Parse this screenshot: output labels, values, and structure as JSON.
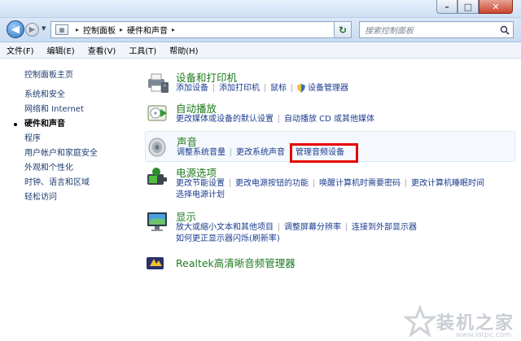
{
  "window": {
    "minimize": "–",
    "maximize": "□",
    "close": "✕"
  },
  "address": {
    "crumbs": [
      "控制面板",
      "硬件和声音"
    ]
  },
  "search": {
    "placeholder": "搜索控制面板"
  },
  "menu": [
    "文件(F)",
    "编辑(E)",
    "查看(V)",
    "工具(T)",
    "帮助(H)"
  ],
  "sidebar": {
    "home": "控制面板主页",
    "items": [
      {
        "label": "系统和安全",
        "active": false
      },
      {
        "label": "网络和 Internet",
        "active": false
      },
      {
        "label": "硬件和声音",
        "active": true
      },
      {
        "label": "程序",
        "active": false
      },
      {
        "label": "用户帐户和家庭安全",
        "active": false
      },
      {
        "label": "外观和个性化",
        "active": false
      },
      {
        "label": "时钟、语言和区域",
        "active": false
      },
      {
        "label": "轻松访问",
        "active": false
      }
    ]
  },
  "sections": [
    {
      "title": "设备和打印机",
      "icon": "printer-icon",
      "links": [
        "添加设备",
        "添加打印机",
        "鼠标",
        "设备管理器"
      ]
    },
    {
      "title": "自动播放",
      "icon": "autoplay-icon",
      "links": [
        "更改媒体或设备的默认设置",
        "自动播放 CD 或其他媒体"
      ]
    },
    {
      "title": "声音",
      "icon": "speaker-icon",
      "links": [
        "调整系统音量",
        "更改系统声音",
        "管理音频设备"
      ]
    },
    {
      "title": "电源选项",
      "icon": "power-icon",
      "links": [
        "更改节能设置",
        "更改电源按钮的功能",
        "唤醒计算机时需要密码",
        "更改计算机睡眠时间",
        "选择电源计划"
      ]
    },
    {
      "title": "显示",
      "icon": "display-icon",
      "links": [
        "放大或缩小文本和其他项目",
        "调整屏幕分辨率",
        "连接到外部显示器",
        "如何更正显示器闪烁(刷新率)"
      ]
    },
    {
      "title": "Realtek高清晰音频管理器",
      "icon": "realtek-icon",
      "links": []
    }
  ],
  "watermark": {
    "text": "装机之家",
    "url": "www.lotpc.com"
  },
  "colors": {
    "title_green": "#1e7a1e",
    "link_blue": "#1a3b8f",
    "highlight_red": "#e50000"
  }
}
